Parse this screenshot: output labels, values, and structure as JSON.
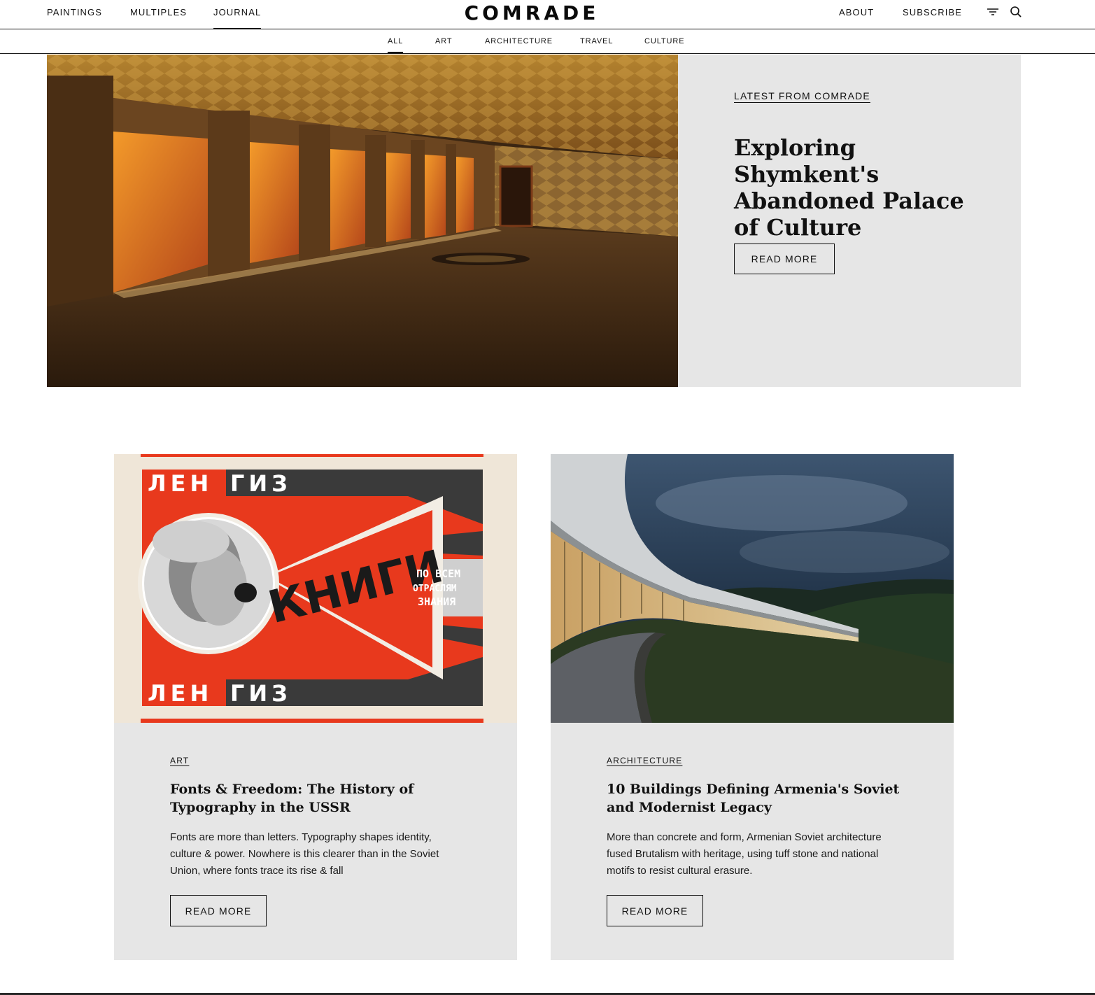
{
  "nav": {
    "left": [
      {
        "label": "PAINTINGS"
      },
      {
        "label": "MULTIPLES"
      },
      {
        "label": "JOURNAL",
        "active": true
      }
    ],
    "logo": "COMRADE",
    "right": [
      {
        "label": "ABOUT"
      },
      {
        "label": "SUBSCRIBE"
      }
    ],
    "icons": [
      "filter-icon",
      "search-icon"
    ]
  },
  "categories": [
    {
      "label": "ALL",
      "active": true
    },
    {
      "label": "ART"
    },
    {
      "label": "ARCHITECTURE"
    },
    {
      "label": "TRAVEL"
    },
    {
      "label": "CULTURE"
    }
  ],
  "hero": {
    "eyebrow": "LATEST FROM COMRADE",
    "title": "Exploring Shymkent's Abandoned Palace of Culture",
    "button": "READ MORE"
  },
  "cards": [
    {
      "tag": "ART",
      "title": "Fonts & Freedom: The History of Typography in the USSR",
      "excerpt": "Fonts are more than letters. Typography shapes identity, culture & power. Nowhere is this clearer than in the Soviet Union, where fonts trace its rise & fall",
      "button": "READ MORE",
      "poster": {
        "top_word": "ЛЕНГИЗ",
        "bottom_word": "ЛЕНГИЗ",
        "center_word": "КНИГИ",
        "side_text": "ПО ВСЕМ ОТРАСЛЯМ ЗНАНИЯ"
      }
    },
    {
      "tag": "ARCHITECTURE",
      "title": "10 Buildings Defining Armenia's Soviet and Modernist Legacy",
      "excerpt": "More than concrete and form, Armenian Soviet architecture fused Brutalism with heritage, using tuff stone and national motifs to resist cultural erasure.",
      "button": "READ MORE"
    }
  ],
  "colors": {
    "panel": "#e6e6e6",
    "text": "#111111",
    "poster_red": "#e8391d"
  }
}
